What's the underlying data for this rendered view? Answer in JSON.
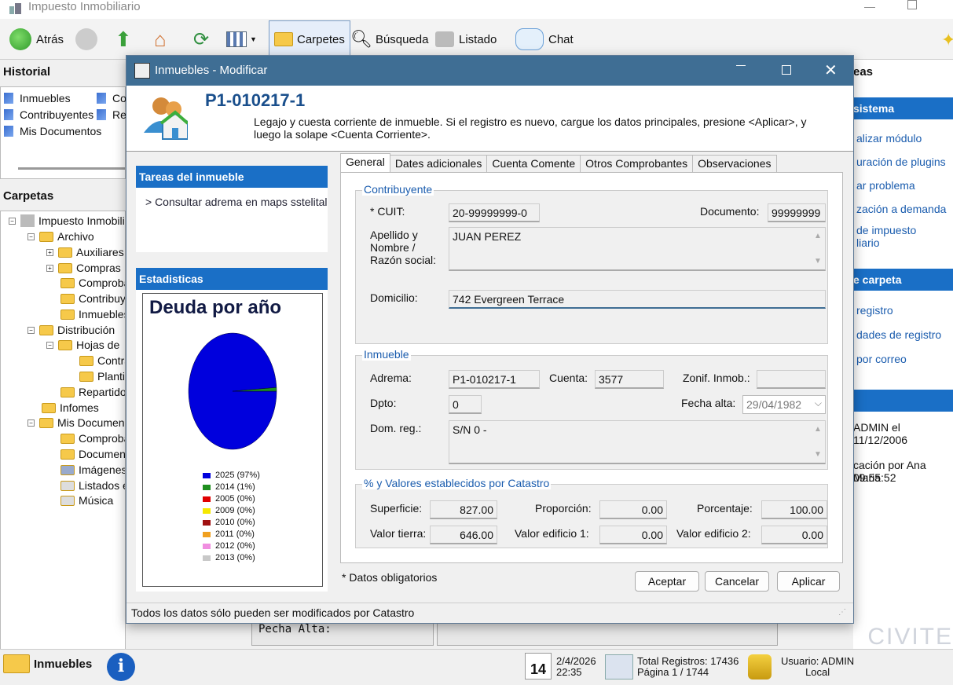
{
  "window": {
    "title": "Impuesto Inmobiliario"
  },
  "toolbar": {
    "back": "Atrás",
    "carpetas": "Carpetes",
    "busqueda": "Búsqueda",
    "listado": "Listado",
    "chat": "Chat"
  },
  "historial": {
    "title": "Historial",
    "items": [
      "Inmuebles",
      "Contribuyentes",
      "Mis Documentos",
      "Co",
      "Re"
    ]
  },
  "carpetas": {
    "title": "Carpetas",
    "tree": [
      "Impuesto Inmobilia",
      "Archivo",
      "Auxiliares",
      "Compras",
      "Comproba",
      "Contribuys",
      "Inmuebles",
      "Distribución",
      "Hojas de",
      "Contra",
      "Planti",
      "Repartido",
      "Infomes",
      "Mis Documen",
      "Comproba",
      "Documen",
      "Imágenes",
      "Listados e",
      "Música"
    ]
  },
  "right": {
    "tareas": "eas",
    "sistema": "sistema",
    "links1": [
      "alizar módulo",
      "uración de plugins",
      "ar problema",
      "zación a demanda",
      "de impuesto",
      "liario"
    ],
    "carpeta": "e carpeta",
    "links2": [
      "registro",
      "dades de registro",
      "por correo"
    ],
    "log1": "ADMIN el 11/12/2006",
    "log2": "cación por Ana Maria",
    "log3": "09:55:52",
    "brand": "CIVITE"
  },
  "bg": {
    "fecha_alta": "Pecha Alta:"
  },
  "status": {
    "module": "Inmuebles",
    "cal_day": "14",
    "date": "2/4/2026",
    "time": "22:35",
    "total": "Total Registros: 17436",
    "page": "Página 1 / 1744",
    "user": "Usuario: ADMIN",
    "local": "Local"
  },
  "dialog": {
    "title": "Inmuebles - Modificar",
    "code": "P1-010217-1",
    "desc": "Legajo y cuesta corriente de inmueble. Si el registro es nuevo, cargue los datos principales, presione <Aplicar>, y luego la solape <Cuenta Corriente>.",
    "tareas_title": "Tareas del inmueble",
    "tarea_link": "> Consultar adrema en maps sstelital",
    "stats_title": "Estadisticas",
    "tabs": [
      "General",
      "Dates adicionales",
      "Cuenta Comente",
      "Otros Comprobantes",
      "Observaciones"
    ],
    "contribuyente": {
      "title": "Contribuyente",
      "cuit_label": "* CUIT:",
      "cuit": "20-99999999-0",
      "doc_label": "Documento:",
      "doc": "99999999",
      "nombre_label": "Apellido y Nombre / Razón social:",
      "nombre": "JUAN PEREZ",
      "dom_label": "Domicilio:",
      "dom": "742 Evergreen Terrace"
    },
    "inmueble": {
      "title": "Inmueble",
      "adrema_label": "Adrema:",
      "adrema": "P1-010217-1",
      "cuenta_label": "Cuenta:",
      "cuenta": "3577",
      "zonif_label": "Zonif. Inmob.:",
      "zonif": "",
      "dpto_label": "Dpto:",
      "dpto": "0",
      "fecha_label": "Fecha alta:",
      "fecha": "29/04/1982",
      "domreg_label": "Dom. reg.:",
      "domreg": "S/N 0 -"
    },
    "catastro": {
      "title": "% y Valores establecidos por Catastro",
      "sup_label": "Superficie:",
      "sup": "827.00",
      "prop_label": "Proporción:",
      "prop": "0.00",
      "porc_label": "Porcentaje:",
      "porc": "100.00",
      "vt_label": "Valor tierra:",
      "vt": "646.00",
      "ve1_label": "Valor edificio 1:",
      "ve1": "0.00",
      "ve2_label": "Valor edificio 2:",
      "ve2": "0.00"
    },
    "obligatorios": "* Datos obligatorios",
    "buttons": {
      "aceptar": "Aceptar",
      "cancelar": "Cancelar",
      "aplicar": "Aplicar"
    },
    "footer": "Todos los datos sólo pueden ser modificados por Catastro"
  },
  "chart_data": {
    "type": "pie",
    "title": "Deuda por año",
    "categories": [
      "2025",
      "2014",
      "2005",
      "2009",
      "2010",
      "2011",
      "2012",
      "2013"
    ],
    "values": [
      97,
      1,
      0,
      0,
      0,
      0,
      0,
      0
    ],
    "legend": [
      "2025 (97%)",
      "2014 (1%)",
      "2005 (0%)",
      "2009 (0%)",
      "2010 (0%)",
      "2011 (0%)",
      "2012 (0%)",
      "2013 (0%)"
    ],
    "colors": [
      "#0000dd",
      "#1f8f1f",
      "#e00000",
      "#f5e800",
      "#a01010",
      "#f0a020",
      "#f08ee0",
      "#c8c8c8"
    ]
  }
}
